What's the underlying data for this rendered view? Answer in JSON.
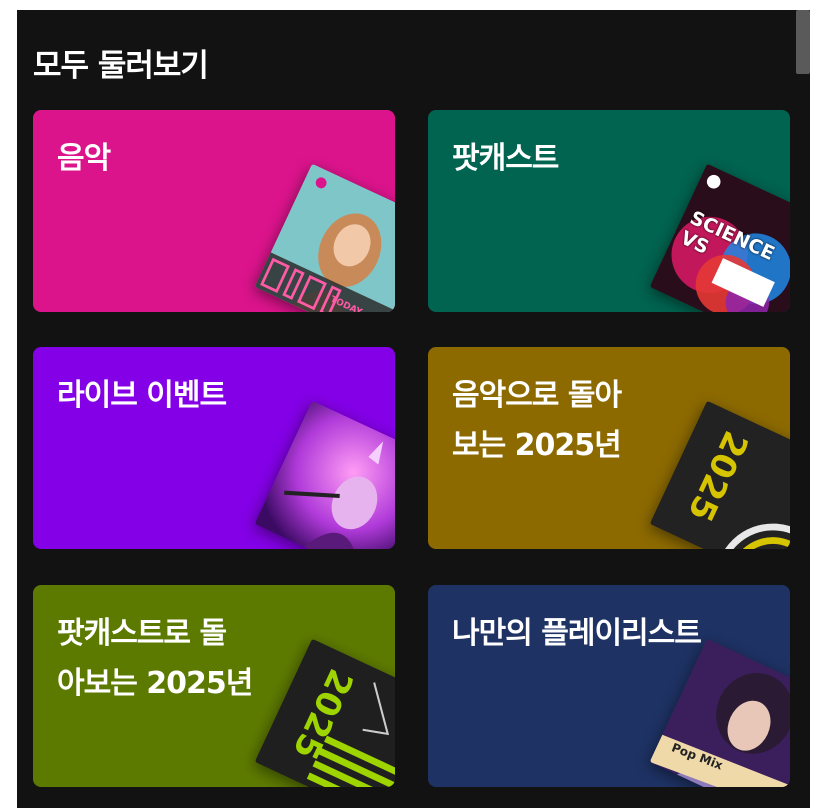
{
  "heading": "모두 둘러보기",
  "cards": [
    {
      "title": "음악",
      "color": "#dc148c",
      "art": {
        "icon": "pop-artist-cover",
        "label": "TODAY"
      }
    },
    {
      "title": "팟캐스트",
      "color": "#006450",
      "art": {
        "icon": "science-podcast-cover",
        "label": "SCIENCE VS"
      }
    },
    {
      "title": "라이브 이벤트",
      "color": "#8400e7",
      "art": {
        "icon": "concert-photo-cover",
        "label": ""
      }
    },
    {
      "title": "음악으로 돌아\n보는 2025년",
      "color": "#8d6a00",
      "art": {
        "icon": "wrapped-2025-cover",
        "label": "2025"
      }
    },
    {
      "title": "팟캐스트로 돌\n아보는 2025년",
      "color": "#5d7a00",
      "art": {
        "icon": "wrapped-2025-podcast-cover",
        "label": "2025"
      }
    },
    {
      "title": "나만의 플레이리스트",
      "color": "#1e3264",
      "art": {
        "icon": "pop-mix-cover",
        "label": "Pop Mix"
      }
    }
  ]
}
